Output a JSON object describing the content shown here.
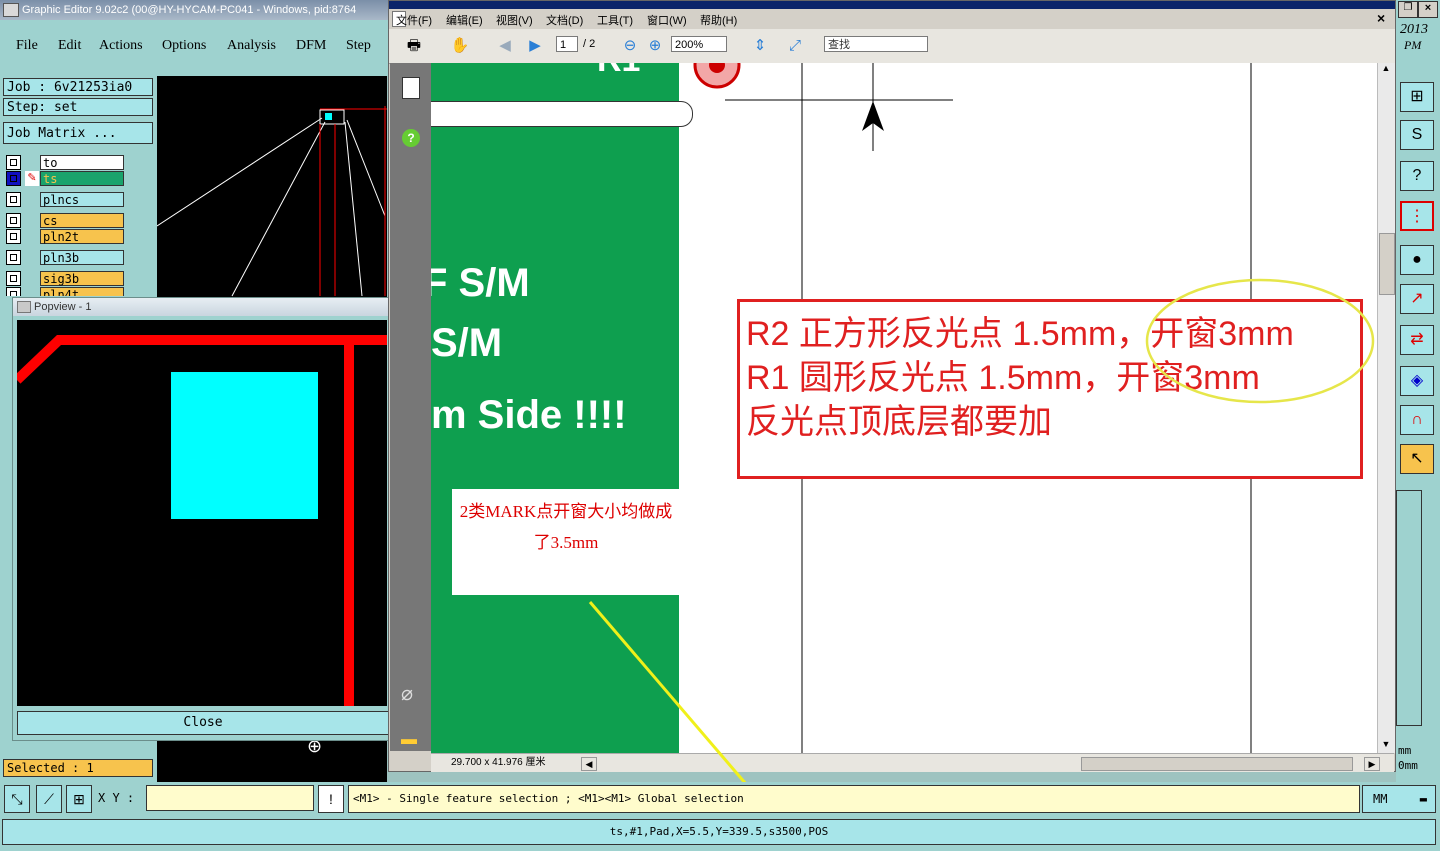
{
  "genesis": {
    "title": "Graphic Editor 9.02c2 (00@HY-HYCAM-PC041 - Windows, pid:8764",
    "menu": [
      "File",
      "Edit",
      "Actions",
      "Options",
      "Analysis",
      "DFM",
      "Step"
    ],
    "job_label": "Job : 6v21253ia0",
    "step_label": "Step: set",
    "job_matrix_label": "Job Matrix ...",
    "layers": [
      {
        "name": "to",
        "color": "#ffffff"
      },
      {
        "name": "ts",
        "color": "#1aa36c"
      },
      {
        "name": "plncs",
        "color": "#a7e5e9"
      },
      {
        "name": "cs",
        "color": "#f7c34d"
      },
      {
        "name": "pln2t",
        "color": "#f7c34d"
      },
      {
        "name": "pln3b",
        "color": "#a7e5e9"
      },
      {
        "name": "sig3b",
        "color": "#f7c34d"
      },
      {
        "name": "pln4t",
        "color": "#f7c34d"
      }
    ],
    "selected": "Selected : 1",
    "clock": [
      "2013",
      "PM"
    ]
  },
  "popview": {
    "title": "Popview - 1",
    "close_label": "Close"
  },
  "reader": {
    "menu": [
      "文件(F)",
      "编辑(E)",
      "视图(V)",
      "文档(D)",
      "工具(T)",
      "窗口(W)",
      "帮助(H)"
    ],
    "page_current": "1",
    "page_total": "/ 2",
    "zoom": "200%",
    "search_placeholder": "查找",
    "page_size": "29.700 x 41.976 厘米",
    "close_glyph": "×",
    "green_text": [
      "F S/M",
      "S/M",
      "m Side !!!!"
    ],
    "green_top_text": "R1",
    "note_lines": [
      "2类MARK点开窗大小均做成",
      "了3.5mm"
    ],
    "red_box_lines": [
      "R2 正方形反光点 1.5mm，开窗3mm",
      "R1 圆形反光点 1.5mm，开窗3mm",
      "反光点顶底层都要加"
    ]
  },
  "right_edge": {
    "labels": [
      "mm",
      "0mm"
    ]
  },
  "command": {
    "xy_label": "X Y :",
    "coord_value": "",
    "prompt": "<M1> - Single feature selection ; <M1><M1> Global selection",
    "units": "MM"
  },
  "status": {
    "line": "ts,#1,Pad,X=5.5,Y=339.5,s3500,POS"
  },
  "colors": {
    "panel": "#9ed2cf",
    "field": "#a7e5e9",
    "highlight": "#f7c34d",
    "cyan_pad": "#00ffff",
    "red_trace": "#ff0000",
    "pdf_green": "#0e9f4f"
  }
}
